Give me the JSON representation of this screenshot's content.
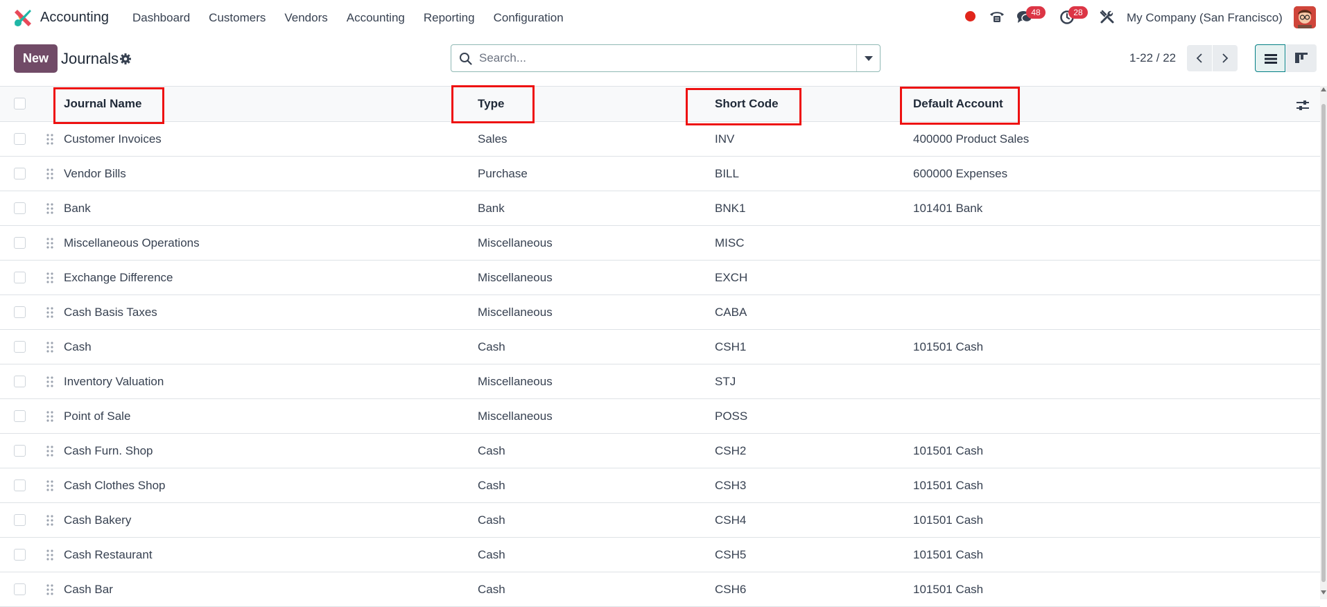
{
  "navbar": {
    "app_name": "Accounting",
    "menu": [
      "Dashboard",
      "Customers",
      "Vendors",
      "Accounting",
      "Reporting",
      "Configuration"
    ],
    "messages_count": "48",
    "activities_count": "28",
    "company": "My Company (San Francisco)"
  },
  "control": {
    "new_label": "New",
    "title": "Journals",
    "search_placeholder": "Search...",
    "pager": "1-22 / 22"
  },
  "table": {
    "headers": [
      "Journal Name",
      "Type",
      "Short Code",
      "Default Account"
    ],
    "rows": [
      {
        "name": "Customer Invoices",
        "type": "Sales",
        "code": "INV",
        "account": "400000 Product Sales"
      },
      {
        "name": "Vendor Bills",
        "type": "Purchase",
        "code": "BILL",
        "account": "600000 Expenses"
      },
      {
        "name": "Bank",
        "type": "Bank",
        "code": "BNK1",
        "account": "101401 Bank"
      },
      {
        "name": "Miscellaneous Operations",
        "type": "Miscellaneous",
        "code": "MISC",
        "account": ""
      },
      {
        "name": "Exchange Difference",
        "type": "Miscellaneous",
        "code": "EXCH",
        "account": ""
      },
      {
        "name": "Cash Basis Taxes",
        "type": "Miscellaneous",
        "code": "CABA",
        "account": ""
      },
      {
        "name": "Cash",
        "type": "Cash",
        "code": "CSH1",
        "account": "101501 Cash"
      },
      {
        "name": "Inventory Valuation",
        "type": "Miscellaneous",
        "code": "STJ",
        "account": ""
      },
      {
        "name": "Point of Sale",
        "type": "Miscellaneous",
        "code": "POSS",
        "account": ""
      },
      {
        "name": "Cash Furn. Shop",
        "type": "Cash",
        "code": "CSH2",
        "account": "101501 Cash"
      },
      {
        "name": "Cash Clothes Shop",
        "type": "Cash",
        "code": "CSH3",
        "account": "101501 Cash"
      },
      {
        "name": "Cash Bakery",
        "type": "Cash",
        "code": "CSH4",
        "account": "101501 Cash"
      },
      {
        "name": "Cash Restaurant",
        "type": "Cash",
        "code": "CSH5",
        "account": "101501 Cash"
      },
      {
        "name": "Cash Bar",
        "type": "Cash",
        "code": "CSH6",
        "account": "101501 Cash"
      }
    ]
  },
  "colors": {
    "brand": "#714b67",
    "accent": "#017e84",
    "badge": "#dc3545",
    "highlight": "#ee1111"
  }
}
